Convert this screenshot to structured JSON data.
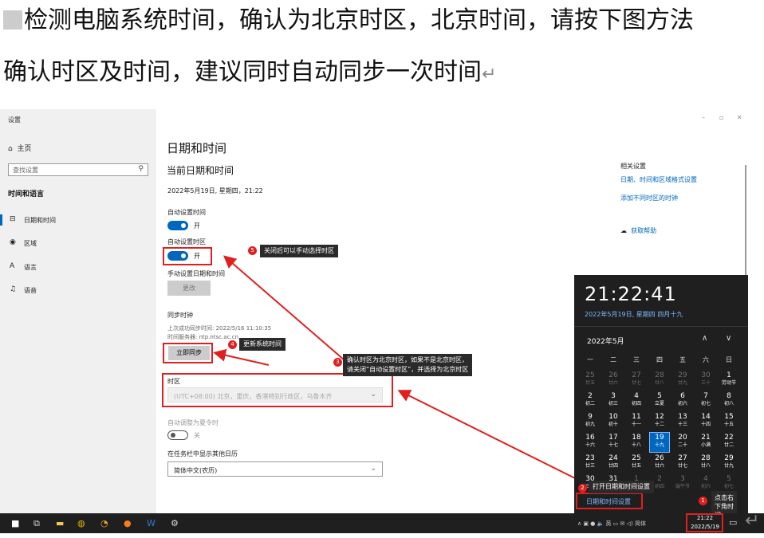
{
  "doc": {
    "line1": "检测电脑系统时间，确认为北京时区，北京时间，请按下图方法",
    "line2": "确认时区及时间，建议同时自动同步一次时间",
    "return_mark": "↵"
  },
  "window": {
    "app_title": "设置",
    "controls": {
      "minimize": "–",
      "maximize": "▫",
      "close": "✕"
    }
  },
  "sidebar": {
    "home_label": "主页",
    "home_icon": "home-icon",
    "search_placeholder": "查找设置",
    "search_icon": "search-icon",
    "section_title": "时间和语言",
    "items": [
      {
        "label": "日期和时间",
        "icon": "calendar-clock-icon",
        "active": true
      },
      {
        "label": "区域",
        "icon": "globe-icon",
        "active": false
      },
      {
        "label": "语言",
        "icon": "language-icon",
        "active": false
      },
      {
        "label": "语音",
        "icon": "microphone-icon",
        "active": false
      }
    ]
  },
  "main": {
    "title": "日期和时间",
    "current_heading": "当前日期和时间",
    "current_value": "2022年5月19日, 星期四，21:22",
    "auto_time": {
      "label": "自动设置时间",
      "state": "开",
      "on": true
    },
    "auto_timezone": {
      "label": "自动设置时区",
      "state": "开",
      "on": true
    },
    "manual": {
      "label": "手动设置日期和时间",
      "button": "更改"
    },
    "sync": {
      "heading": "同步时钟",
      "last_sync": "上次成功同步时间: 2022/5/16 11:10:35",
      "server": "时间服务器: ntp.ntsc.ac.cn",
      "button": "立即同步"
    },
    "timezone": {
      "label": "时区",
      "value": "(UTC+08:00) 北京，重庆，香港特别行政区，乌鲁木齐"
    },
    "dst": {
      "label": "自动调整为夏令时",
      "state": "关",
      "on": false
    },
    "extra_calendar": {
      "label": "在任务栏中显示其他日历",
      "value": "简体中文(农历)"
    }
  },
  "related": {
    "heading": "相关设置",
    "links": [
      "日期、时间和区域格式设置",
      "添加不同时区的时钟"
    ],
    "help": "获取帮助",
    "help_icon": "help-chat-icon"
  },
  "annotations": [
    {
      "num": "5",
      "text": "关闭后可以手动选择时区"
    },
    {
      "num": "4",
      "text": "更新系统时间"
    },
    {
      "num": "3",
      "text": "确认时区为北京时区，如果不是北京时区，",
      "text2": "请关闭“自动设置时区”，并选择为北京时区"
    },
    {
      "num": "2",
      "text": "打开日期和时间设置"
    },
    {
      "num": "1",
      "text": "点击右",
      "text2": "下角时",
      "text3": "间"
    }
  ],
  "flyout": {
    "time": "21:22:41",
    "date": "2022年5月19日, 星期四 四月十九",
    "month": "2022年5月",
    "nav": {
      "up": "∧",
      "down": "∨"
    },
    "weekdays": [
      "一",
      "二",
      "三",
      "四",
      "五",
      "六",
      "日"
    ],
    "weeks": [
      [
        {
          "d": "25",
          "l": "廿五",
          "dim": true
        },
        {
          "d": "26",
          "l": "廿六",
          "dim": true
        },
        {
          "d": "27",
          "l": "廿七",
          "dim": true
        },
        {
          "d": "28",
          "l": "廿八",
          "dim": true
        },
        {
          "d": "29",
          "l": "廿九",
          "dim": true
        },
        {
          "d": "30",
          "l": "三十",
          "dim": true
        },
        {
          "d": "1",
          "l": "劳动节"
        }
      ],
      [
        {
          "d": "2",
          "l": "初二"
        },
        {
          "d": "3",
          "l": "初三"
        },
        {
          "d": "4",
          "l": "初四"
        },
        {
          "d": "5",
          "l": "立夏"
        },
        {
          "d": "6",
          "l": "初六"
        },
        {
          "d": "7",
          "l": "初七"
        },
        {
          "d": "8",
          "l": "初八"
        }
      ],
      [
        {
          "d": "9",
          "l": "初九"
        },
        {
          "d": "10",
          "l": "初十"
        },
        {
          "d": "11",
          "l": "十一"
        },
        {
          "d": "12",
          "l": "十二"
        },
        {
          "d": "13",
          "l": "十三"
        },
        {
          "d": "14",
          "l": "十四"
        },
        {
          "d": "15",
          "l": "十五"
        }
      ],
      [
        {
          "d": "16",
          "l": "十六"
        },
        {
          "d": "17",
          "l": "十七"
        },
        {
          "d": "18",
          "l": "十八"
        },
        {
          "d": "19",
          "l": "十九",
          "today": true
        },
        {
          "d": "20",
          "l": "二十"
        },
        {
          "d": "21",
          "l": "小满"
        },
        {
          "d": "22",
          "l": "廿二"
        }
      ],
      [
        {
          "d": "23",
          "l": "廿三"
        },
        {
          "d": "24",
          "l": "廿四"
        },
        {
          "d": "25",
          "l": "廿五"
        },
        {
          "d": "26",
          "l": "廿六"
        },
        {
          "d": "27",
          "l": "廿七"
        },
        {
          "d": "28",
          "l": "廿八"
        },
        {
          "d": "29",
          "l": "廿九"
        }
      ],
      [
        {
          "d": "30",
          "l": "三十"
        },
        {
          "d": "31",
          "l": "五月"
        },
        {
          "d": "1",
          "l": "儿童节",
          "dim": true
        },
        {
          "d": "2",
          "l": "初四",
          "dim": true
        },
        {
          "d": "3",
          "l": "端午节",
          "dim": true
        },
        {
          "d": "4",
          "l": "初六",
          "dim": true
        },
        {
          "d": "5",
          "l": "初七",
          "dim": true
        }
      ]
    ],
    "settings_link": "日期和时间设置"
  },
  "taskbar": {
    "icons": [
      "windows-start-icon",
      "task-view-icon",
      "file-explorer-icon",
      "chrome-icon",
      "app-icon",
      "browser-icon",
      "word-icon",
      "settings-gear-icon"
    ],
    "tray_text": "∧ ▣ ● 🔈 英 ▭ ✉ ◁) 简体",
    "time": "21:22",
    "date": "2022/5/19"
  },
  "colors": {
    "accent": "#0067c0",
    "annotation_red": "#e02020",
    "flyout_bg": "#1f1f1f",
    "sidebar_bg": "#f0f0f0"
  }
}
